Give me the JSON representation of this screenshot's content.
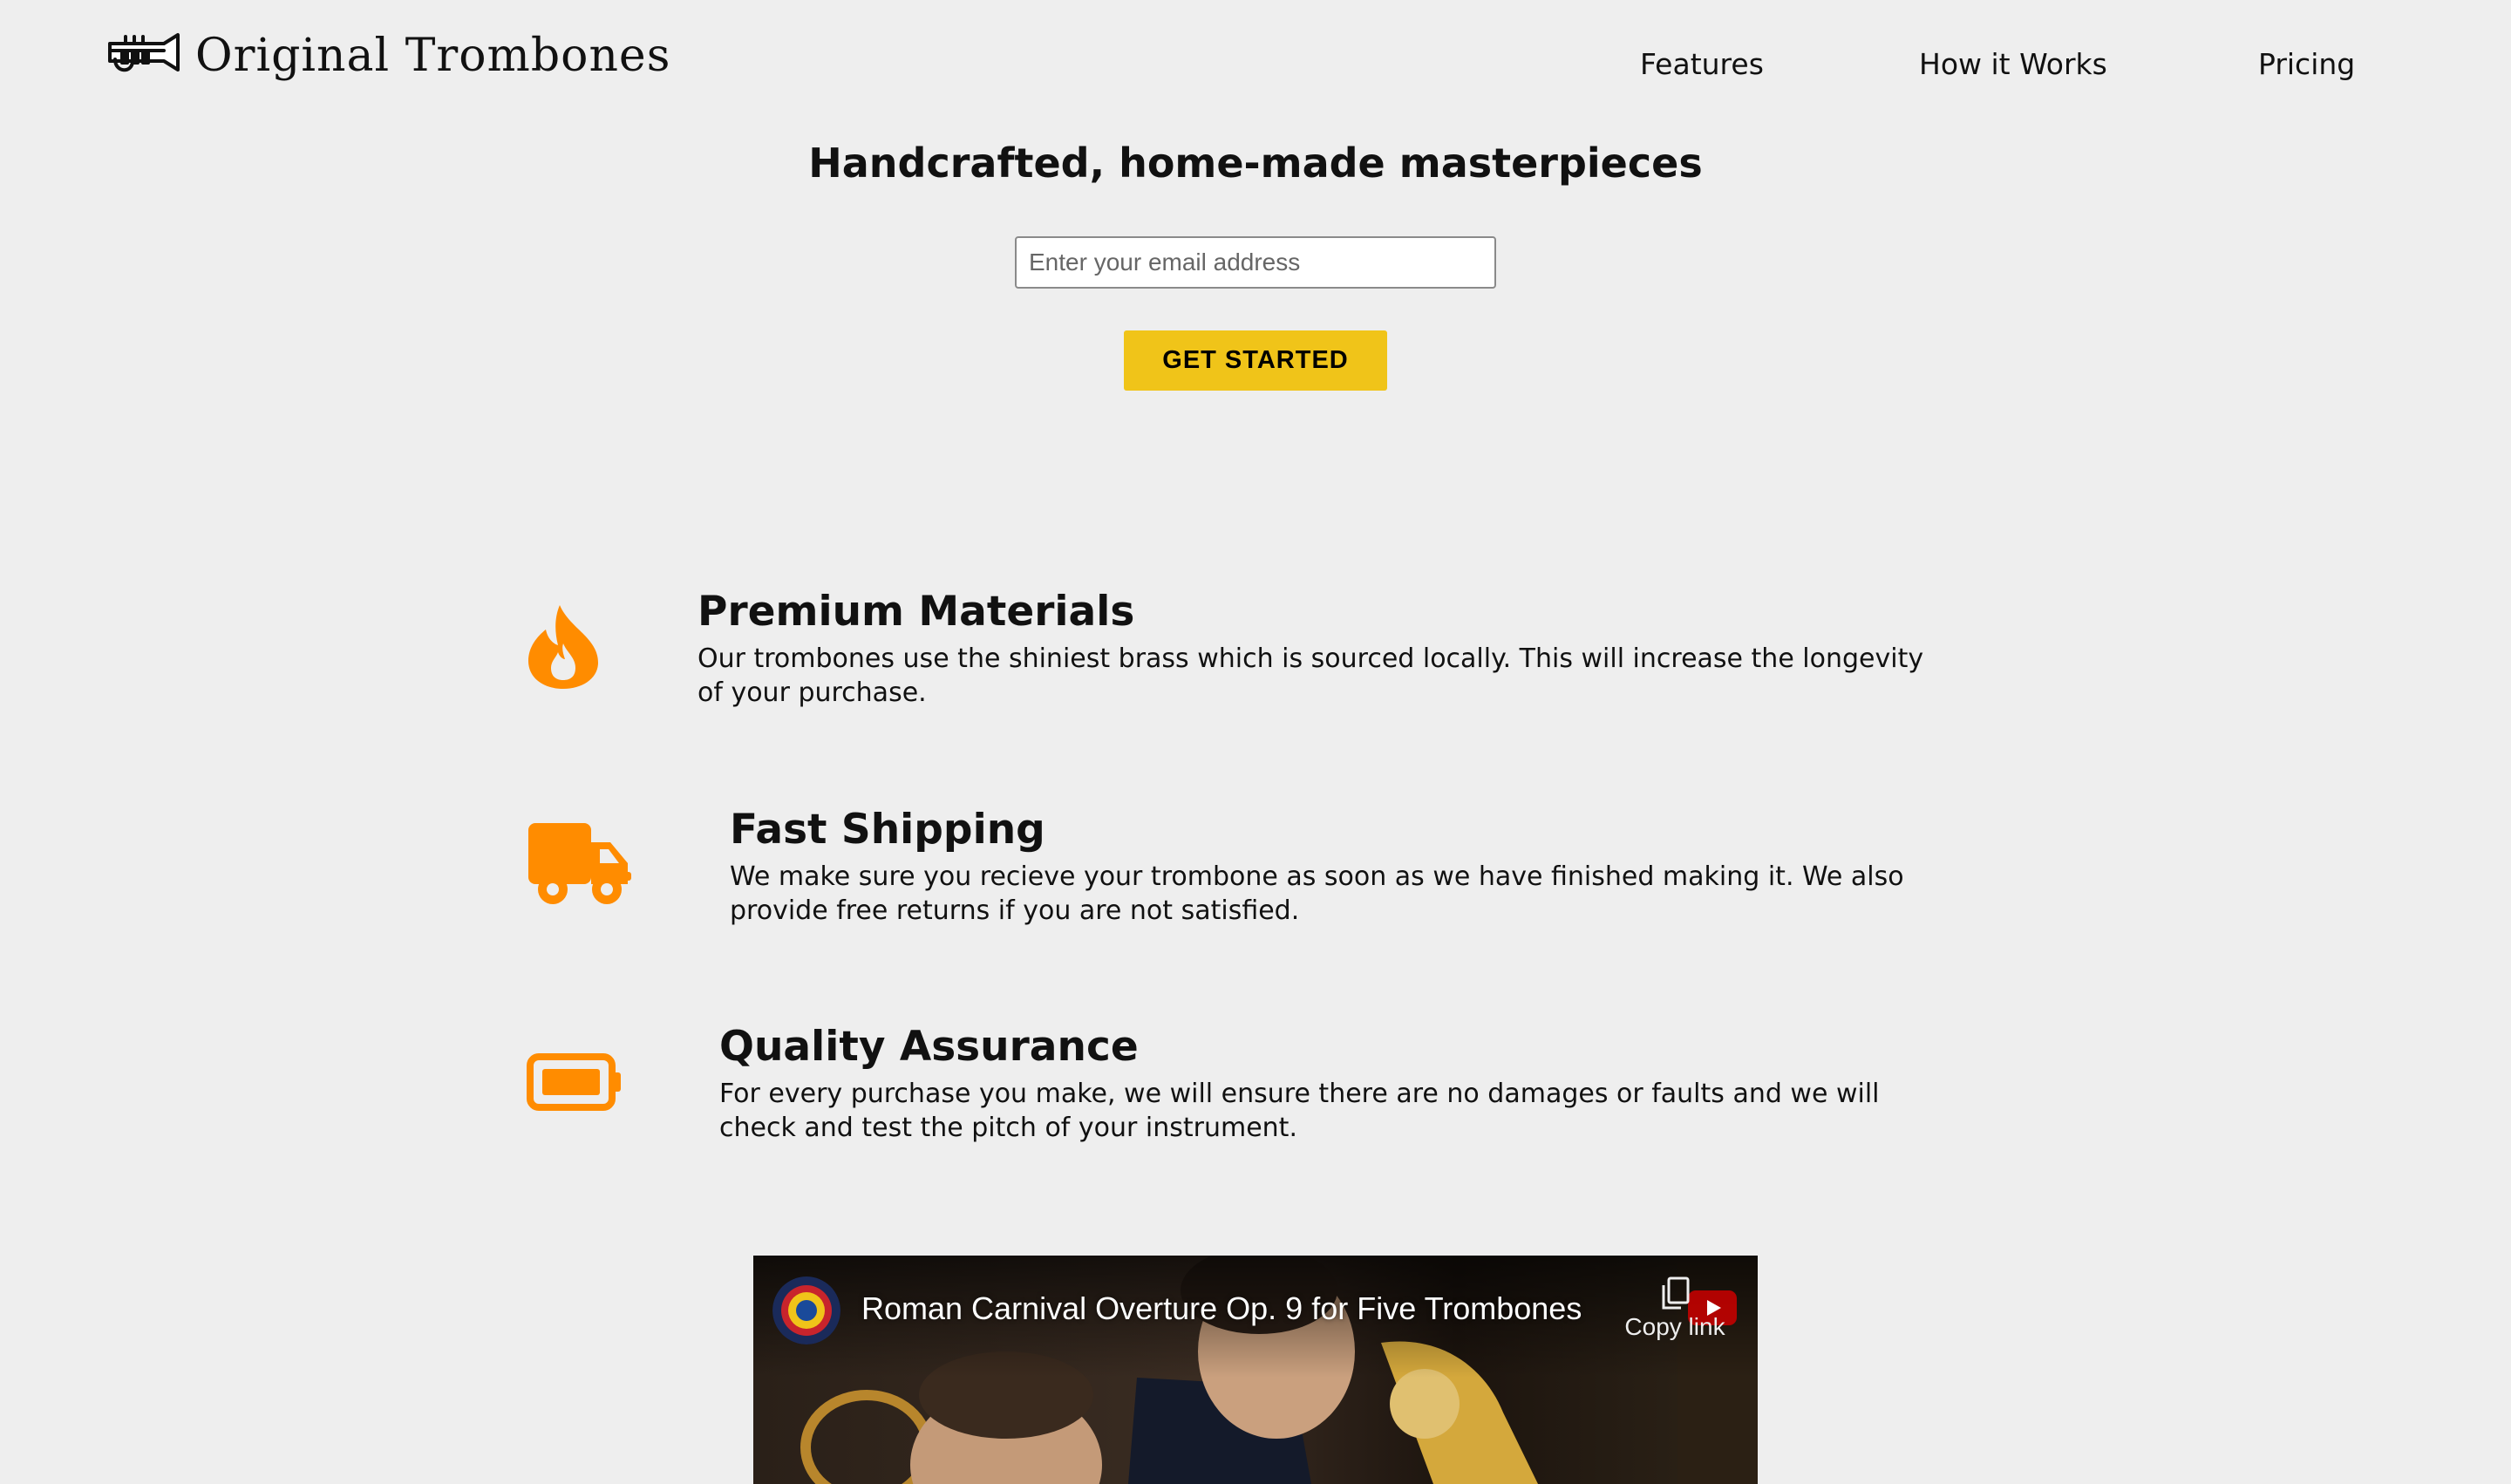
{
  "header": {
    "brand": "Original Trombones",
    "logo_icon": "trumpet-icon",
    "nav": [
      {
        "label": "Features"
      },
      {
        "label": "How it Works"
      },
      {
        "label": "Pricing"
      }
    ]
  },
  "hero": {
    "title": "Handcrafted, home-made masterpieces",
    "email_placeholder": "Enter your email address",
    "cta_label": "GET STARTED"
  },
  "features": [
    {
      "icon": "fire-icon",
      "title": "Premium Materials",
      "description": "Our trombones use the shiniest brass which is sourced locally. This will increase the longevity of your purchase."
    },
    {
      "icon": "truck-icon",
      "title": "Fast Shipping",
      "description": "We make sure you recieve your trombone as soon as we have finished making it. We also provide free returns if you are not satisfied."
    },
    {
      "icon": "battery-icon",
      "title": "Quality Assurance",
      "description": "For every purchase you make, we will ensure there are no damages or faults and we will check and test the pitch of your instrument."
    }
  ],
  "video": {
    "title": "Roman Carnival Overture Op. 9 for Five Trombones",
    "copy_link_label": "Copy link"
  },
  "colors": {
    "background": "#eeeeee",
    "accent_orange": "#ff8c00",
    "cta_yellow": "#f0c419"
  }
}
